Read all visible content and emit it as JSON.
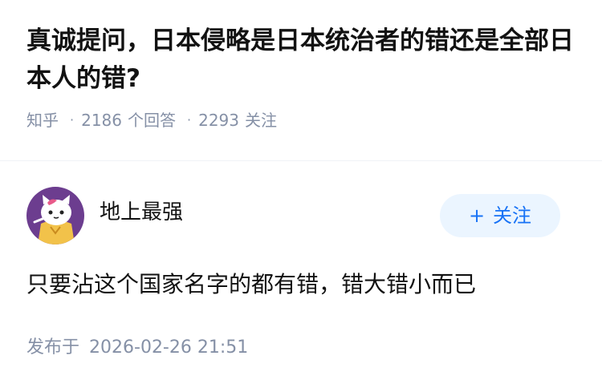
{
  "question": {
    "title": "真诚提问，日本侵略是日本统治者的错还是全部日本人的错?",
    "source": "知乎",
    "answers_count": "2186",
    "answers_label": "个回答",
    "followers_count": "2293",
    "followers_label": "关注"
  },
  "answer": {
    "author_name": "地上最强",
    "follow_button_plus": "+",
    "follow_button_label": "关注",
    "content": "只要沾这个国家名字的都有错，错大错小而已",
    "published_label": "发布于",
    "published_time": "2026-02-26 21:51"
  },
  "colors": {
    "primary": "#1772f6",
    "secondary_text": "#8590a6",
    "follow_bg": "#ebf5ff",
    "avatar_bg": "#6c3d8f"
  }
}
